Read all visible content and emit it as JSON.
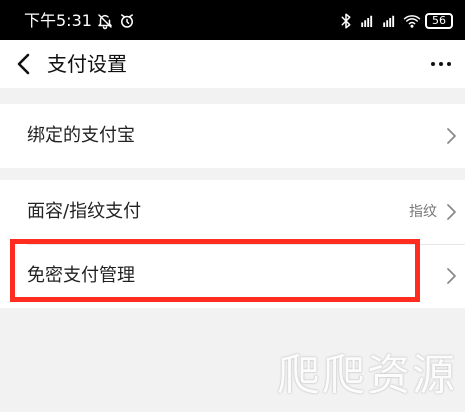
{
  "status_bar": {
    "time": "下午5:31",
    "left_icons": [
      "mute-bell-icon",
      "alarm-clock-icon"
    ],
    "right_icons": [
      "bluetooth-icon",
      "signal-hd-icon",
      "signal-hd-icon",
      "wifi-icon"
    ],
    "battery_level": "56"
  },
  "header": {
    "title": "支付设置",
    "back_icon": "chevron-left-icon",
    "more_icon": "more-horizontal-icon"
  },
  "settings": {
    "group1": [
      {
        "label": "绑定的支付宝",
        "value": "",
        "icon": "chevron-right-icon"
      }
    ],
    "group2": [
      {
        "label": "面容/指纹支付",
        "value": "指纹",
        "icon": "chevron-right-icon"
      },
      {
        "label": "免密支付管理",
        "value": "",
        "icon": "chevron-right-icon"
      }
    ]
  },
  "overlay": {
    "highlight_color": "#ff2c1f",
    "watermark_text": "爬爬资源"
  },
  "colors": {
    "background": "#f2f2f2",
    "surface": "#ffffff",
    "text_primary": "#222222",
    "text_secondary": "#777777",
    "status_bar": "#000000"
  }
}
